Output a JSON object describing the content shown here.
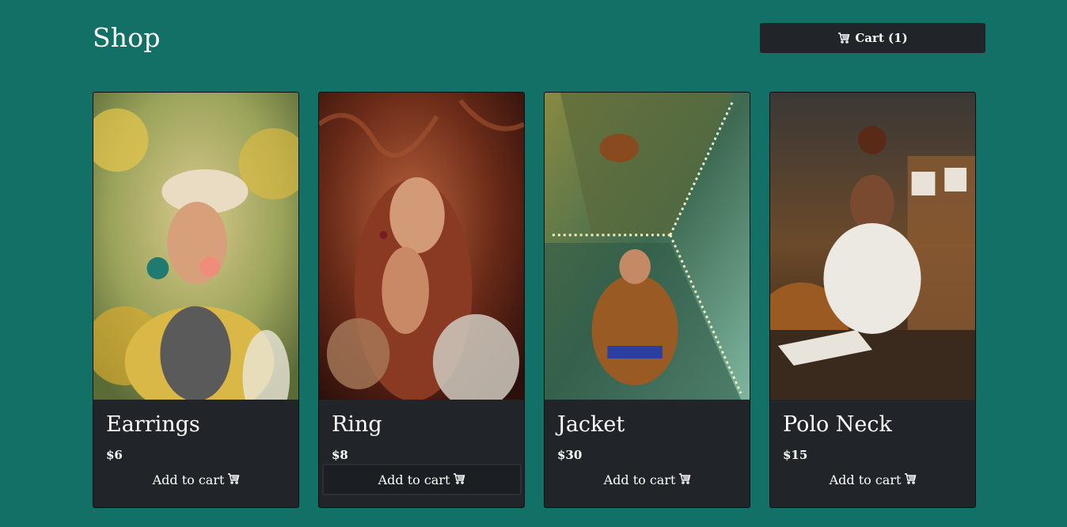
{
  "header": {
    "title": "Shop",
    "cart_label": "Cart (1)"
  },
  "products": [
    {
      "name": "Earrings",
      "price": "$6",
      "button": "Add to cart",
      "image": "woman-beret-yellow-flowers"
    },
    {
      "name": "Ring",
      "price": "$8",
      "button": "Add to cart",
      "image": "woman-red-hair-ferns"
    },
    {
      "name": "Jacket",
      "price": "$30",
      "button": "Add to cart",
      "image": "mirror-elevator-brown-jacket"
    },
    {
      "name": "Polo Neck",
      "price": "$15",
      "button": "Add to cart",
      "image": "woman-white-polo-neck-restaurant"
    }
  ],
  "colors": {
    "background": "#127066",
    "card": "#212429",
    "text": "#ffffff"
  },
  "icons": {
    "cart": "shopping-cart-icon"
  }
}
